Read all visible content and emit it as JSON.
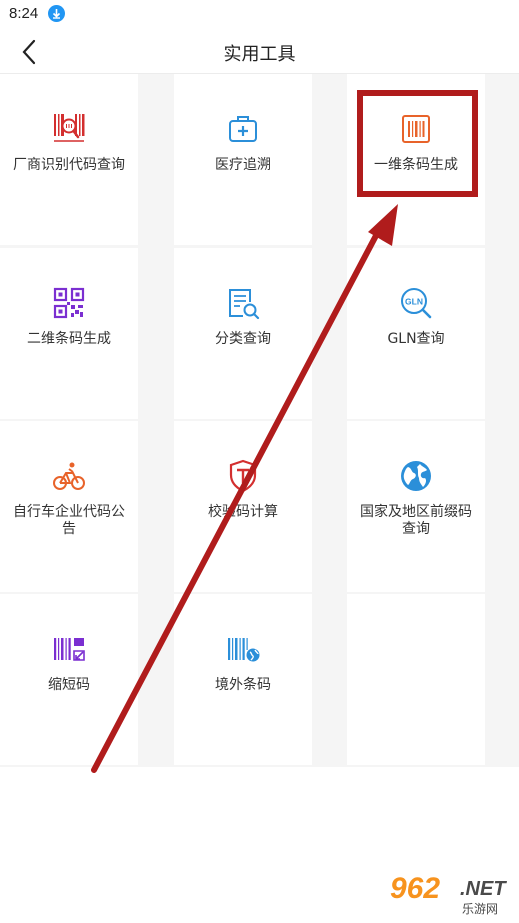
{
  "status_bar": {
    "time": "8:24"
  },
  "header": {
    "title": "实用工具"
  },
  "tools": [
    {
      "label": "厂商识别代码查询",
      "icon": "barcode-search-icon",
      "color": "#d32f2f"
    },
    {
      "label": "医疗追溯",
      "icon": "medical-kit-icon",
      "color": "#2b8fd9"
    },
    {
      "label": "一维条码生成",
      "icon": "barcode-icon",
      "color": "#e8632a"
    },
    {
      "label": "二维条码生成",
      "icon": "qr-code-icon",
      "color": "#7b2fd1"
    },
    {
      "label": "分类查询",
      "icon": "list-search-icon",
      "color": "#2b8fd9"
    },
    {
      "label": "GLN查询",
      "icon": "gln-search-icon",
      "color": "#2b8fd9"
    },
    {
      "label": "自行车企业代码公告",
      "icon": "bicycle-icon",
      "color": "#e8632a"
    },
    {
      "label": "校验码计算",
      "icon": "shield-t-icon",
      "color": "#d32f2f"
    },
    {
      "label": "国家及地区前缀码查询",
      "icon": "globe-icon",
      "color": "#2b8fd9"
    },
    {
      "label": "缩短码",
      "icon": "barcode-shrink-icon",
      "color": "#7b2fd1"
    },
    {
      "label": "境外条码",
      "icon": "barcode-globe-icon",
      "color": "#2b8fd9"
    }
  ],
  "watermark": {
    "number": "962",
    "suffix": ".NET",
    "subtitle": "乐游网"
  },
  "annotation": {
    "highlight_color": "#b01c1c"
  }
}
